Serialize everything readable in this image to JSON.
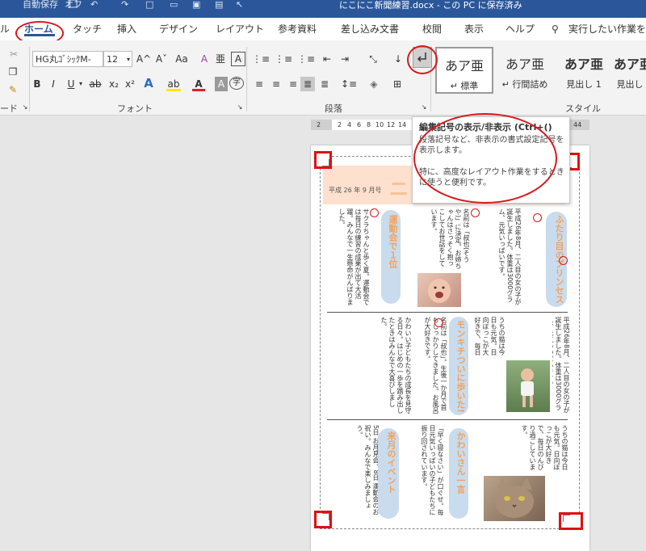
{
  "titlebar": {
    "title": "にこにこ新聞練習.docx - この PC に保存済み",
    "autosave": "自動保存",
    "autosave_state": "オフ"
  },
  "tabs": [
    {
      "label": "ホーム",
      "active": true
    },
    {
      "label": "タッチ"
    },
    {
      "label": "挿入"
    },
    {
      "label": "デザイン"
    },
    {
      "label": "レイアウト"
    },
    {
      "label": "参考資料"
    },
    {
      "label": "差し込み文書"
    },
    {
      "label": "校閲"
    },
    {
      "label": "表示"
    },
    {
      "label": "ヘルプ"
    }
  ],
  "tell_me": "実行したい作業を入",
  "ribbon": {
    "font_name": "HG丸ｺﾞｼｯｸM-",
    "font_size": "12",
    "grow_font": "A^",
    "shrink_font": "Aˇ",
    "change_case": "Aa",
    "clear_format": "A",
    "ruby": "亜",
    "border_char": "A",
    "bold": "B",
    "italic": "I",
    "underline": "U",
    "strike": "ab",
    "subscript": "x₂",
    "superscript": "x²",
    "text_effect": "A",
    "highlight": "ab",
    "font_color": "A",
    "char_shading": "A",
    "enclose": "字",
    "font_group": "フォント",
    "paragraph_group": "段落",
    "style_group": "スタイル",
    "clipboard_group": "ード",
    "styles": [
      {
        "preview": "あア亜",
        "name": "標準",
        "mark": "↵"
      },
      {
        "preview": "あア亜",
        "name": "行間詰め",
        "mark": "↵"
      },
      {
        "preview": "あア亜",
        "name": "見出し 1"
      },
      {
        "preview": "あア亜",
        "name": "見出し"
      }
    ]
  },
  "tooltip": {
    "title": "編集記号の表示/非表示 (Ctrl+()",
    "line1": "段落記号など、非表示の書式設定記号を表示します。",
    "line2": "特に、高度なレイアウト作業をするときに使うと便利です。"
  },
  "ruler": {
    "left": "2",
    "ticks": [
      "2",
      "4",
      "6",
      "8",
      "10",
      "12",
      "14"
    ],
    "right": "44"
  },
  "document": {
    "date": "平成 26 年 9 月号",
    "title_partial": "ニ",
    "headings": [
      "運動会で１位",
      "ふたり目のプリンセス誕生!",
      "モンキチついに歩いた!",
      "かわいさん一言",
      "来月のイベント"
    ],
    "col1_text": "サクラちゃんと歩く夏。運動会では毎日の練習の成果が出て大活躍。みんなで一生懸命がんばりました。",
    "col2_text": "名前は「叔也(そうや)」に決定。お姉ちゃんはさっそく抱っこしてお世話をしています。",
    "col3_text": "平成26年8月、二人目の女の子が誕生しました。体重は3000グラム、元気いっぱいです。",
    "col4_text": "かわいい子どもたちの成長を見守る日々。はじめの一歩を踏み出したときはみんなで大喜びしました。",
    "col5_text": "名前は「叔也」。生後一か月で首もしっかりしてきました。お風呂が大好きです。",
    "col6_text": "「早く寝なさい」が口ぐせ。毎日元気いっぱいの子どもたちに振り回されています。",
    "col7_text": "5日 お月見会。8日 運動会のお祝い。みんなで楽しみましょう。",
    "col8_text": "うちの猫は今日も元気。日向ぼっこが大好きで、毎日のんびり過ごしています。"
  }
}
